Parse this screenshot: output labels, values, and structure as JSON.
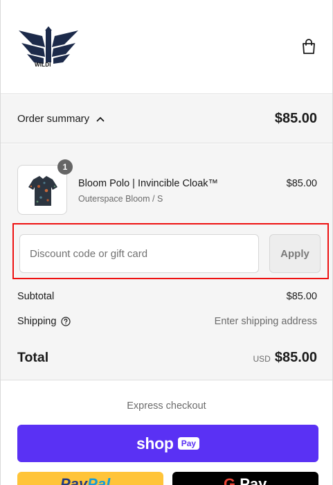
{
  "brand": {
    "logo_text": "WILDI"
  },
  "summary": {
    "toggle_label": "Order summary",
    "total": "$85.00"
  },
  "product": {
    "name": "Bloom Polo | Invincible Cloak™",
    "variant": "Outerspace Bloom / S",
    "price": "$85.00",
    "quantity": "1"
  },
  "discount": {
    "placeholder": "Discount code or gift card",
    "apply_label": "Apply"
  },
  "totals": {
    "subtotal_label": "Subtotal",
    "subtotal_value": "$85.00",
    "shipping_label": "Shipping",
    "shipping_value": "Enter shipping address",
    "total_label": "Total",
    "currency": "USD",
    "total_value": "$85.00"
  },
  "express": {
    "label": "Express checkout",
    "shop_word": "shop",
    "shop_badge": "Pay",
    "paypal_part1": "Pay",
    "paypal_part2": "Pal",
    "gpay_g": "G",
    "gpay_word": "Pay"
  },
  "colors": {
    "shop_pay": "#5a31f4",
    "paypal": "#ffc439",
    "gpay": "#000000",
    "highlight": "#ee1111"
  }
}
